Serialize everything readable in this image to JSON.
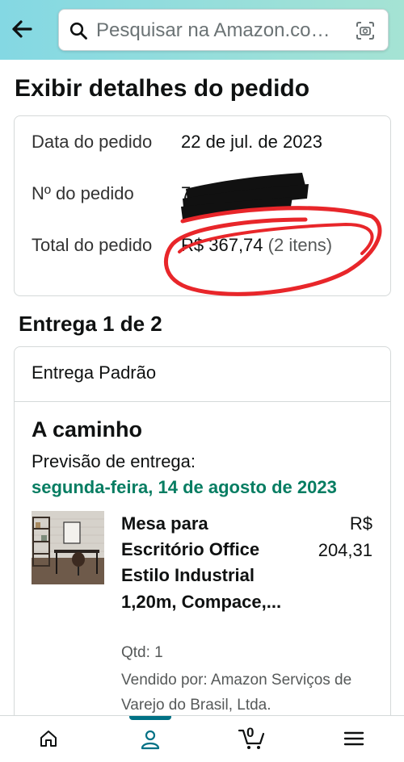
{
  "header": {
    "search_placeholder": "Pesquisar na Amazon.co…"
  },
  "page_title": "Exibir detalhes do pedido",
  "order_summary": {
    "order_date_label": "Data do pedido",
    "order_date": "22 de jul. de 2023",
    "order_number_label": "Nº do pedido",
    "order_number_visible": "70",
    "order_total_label": "Total do pedido",
    "order_total": "R$ 367,74",
    "item_count": "(2 itens)"
  },
  "delivery": {
    "heading": "Entrega 1 de 2",
    "method": "Entrega Padrão",
    "status": "A caminho",
    "eta_label": "Previsão de entrega:",
    "eta_date": "segunda-feira, 14 de agosto de 2023",
    "eta_color": "#067d62",
    "item": {
      "title": "Mesa para Escritório Office Estilo Industrial 1,20m, Compace,...",
      "price_currency": "R$",
      "price_value": "204,31",
      "quantity": "Qtd: 1",
      "seller": "Vendido por: Amazon Serviços de Varejo do Brasil, Ltda."
    }
  },
  "bottom_nav": {
    "items": [
      "home-icon",
      "account-icon",
      "cart-icon",
      "menu-icon"
    ],
    "active": "account-icon",
    "cart_count": "0",
    "accent": "#007185"
  }
}
